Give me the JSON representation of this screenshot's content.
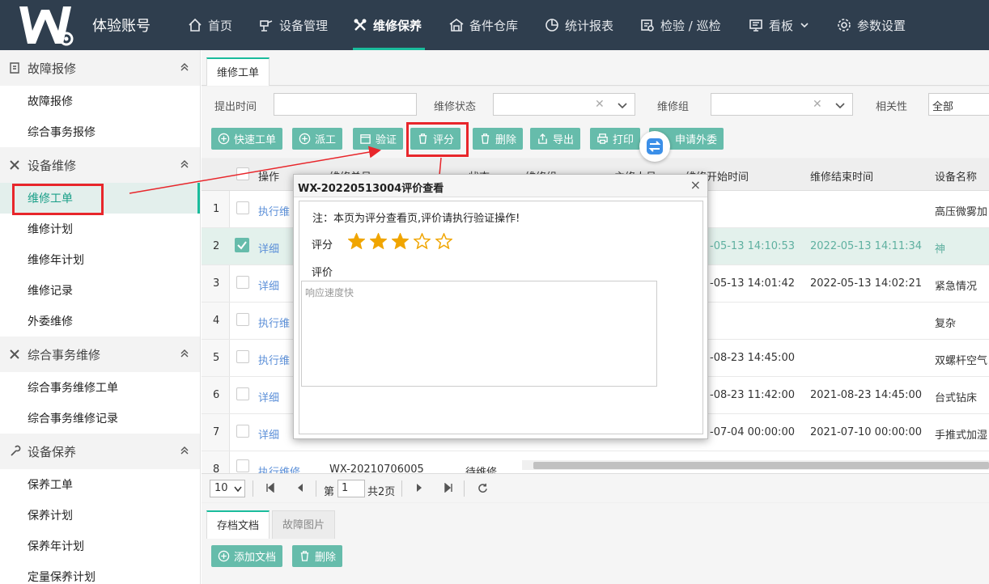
{
  "app": {
    "brand": "体验账号",
    "logo_letter": "W"
  },
  "nav": [
    {
      "label": "首页",
      "icon": "home-icon"
    },
    {
      "label": "设备管理",
      "icon": "device-icon"
    },
    {
      "label": "维修保养",
      "icon": "tools-icon",
      "active": true
    },
    {
      "label": "备件仓库",
      "icon": "warehouse-icon"
    },
    {
      "label": "统计报表",
      "icon": "pie-chart-icon"
    },
    {
      "label": "检验 / 巡检",
      "icon": "inspect-icon"
    },
    {
      "label": "看板",
      "icon": "board-icon",
      "has_dropdown": true
    },
    {
      "label": "参数设置",
      "icon": "gear-icon"
    }
  ],
  "sidebar": {
    "groups": [
      {
        "label": "故障报修",
        "items": [
          "故障报修",
          "综合事务报修"
        ]
      },
      {
        "label": "设备维修",
        "items": [
          "维修工单",
          "维修计划",
          "维修年计划",
          "维修记录",
          "外委维修"
        ]
      },
      {
        "label": "综合事务维修",
        "items": [
          "综合事务维修工单",
          "综合事务维修记录"
        ]
      },
      {
        "label": "设备保养",
        "items": [
          "保养工单",
          "保养计划",
          "保养年计划",
          "定量保养计划"
        ]
      }
    ],
    "active_item": "维修工单"
  },
  "tabs": {
    "main": "维修工单",
    "doc": "存档文档",
    "img": "故障图片"
  },
  "filters": {
    "time_label": "提出时间",
    "status_label": "维修状态",
    "group_label": "维修组",
    "relevance_label": "相关性",
    "relevance_value": "全部"
  },
  "toolbar": {
    "quick": "快速工单",
    "dispatch": "派工",
    "verify": "验证",
    "rate": "评分",
    "delete": "删除",
    "export": "导出",
    "print": "打印",
    "outsource": "申请外委"
  },
  "grid": {
    "headers": [
      "操作",
      "维修单号",
      "状态",
      "维修组",
      "主修人员",
      "维修开始时间",
      "维修结束时间",
      "设备名称"
    ],
    "rows": [
      {
        "n": "1",
        "op": "执行维",
        "start": "",
        "end": "",
        "device": "高压微雾加",
        "checked": false
      },
      {
        "n": "2",
        "op": "详细",
        "start": "-05-13 14:10:53",
        "end": "2022-05-13 14:11:34",
        "device": "神",
        "checked": true
      },
      {
        "n": "3",
        "op": "详细",
        "start": "-05-13 14:01:42",
        "end": "2022-05-13 14:02:21",
        "device": "紧急情况",
        "checked": false
      },
      {
        "n": "4",
        "op": "执行维",
        "start": "",
        "end": "",
        "device": "复杂",
        "checked": false
      },
      {
        "n": "5",
        "op": "执行维",
        "start": "-08-23 14:45:00",
        "end": "",
        "device": "双螺杆空气",
        "checked": false
      },
      {
        "n": "6",
        "op": "详细",
        "start": "-08-23 11:42:00",
        "end": "2021-08-23 14:45:00",
        "device": "台式钻床",
        "checked": false
      },
      {
        "n": "7",
        "op": "详细",
        "start": "-07-04 00:00:00",
        "end": "2021-07-10 00:00:00",
        "device": "手推式加湿",
        "checked": false
      },
      {
        "n": "8",
        "op": "执行维修",
        "code": "WX-20210706005",
        "status": "待维修",
        "checked": false
      }
    ]
  },
  "pager": {
    "page_size": "10",
    "page_prefix": "第",
    "page_value": "1",
    "total": "共2页"
  },
  "lower": {
    "add_doc": "添加文档",
    "delete": "删除"
  },
  "dialog": {
    "title": "WX-20220513004评价查看",
    "close": "×",
    "note": "注：本页为评分查看页,评价请执行验证操作!",
    "score_label": "评分",
    "rating": 3,
    "max_rating": 5,
    "comment_label": "评价",
    "comment": "响应速度快"
  },
  "colors": {
    "topbar": "#2f3e4e",
    "accent": "#1abc9c",
    "button": "#66bcab",
    "highlight": "#e8262b",
    "star": "#f0a500"
  }
}
